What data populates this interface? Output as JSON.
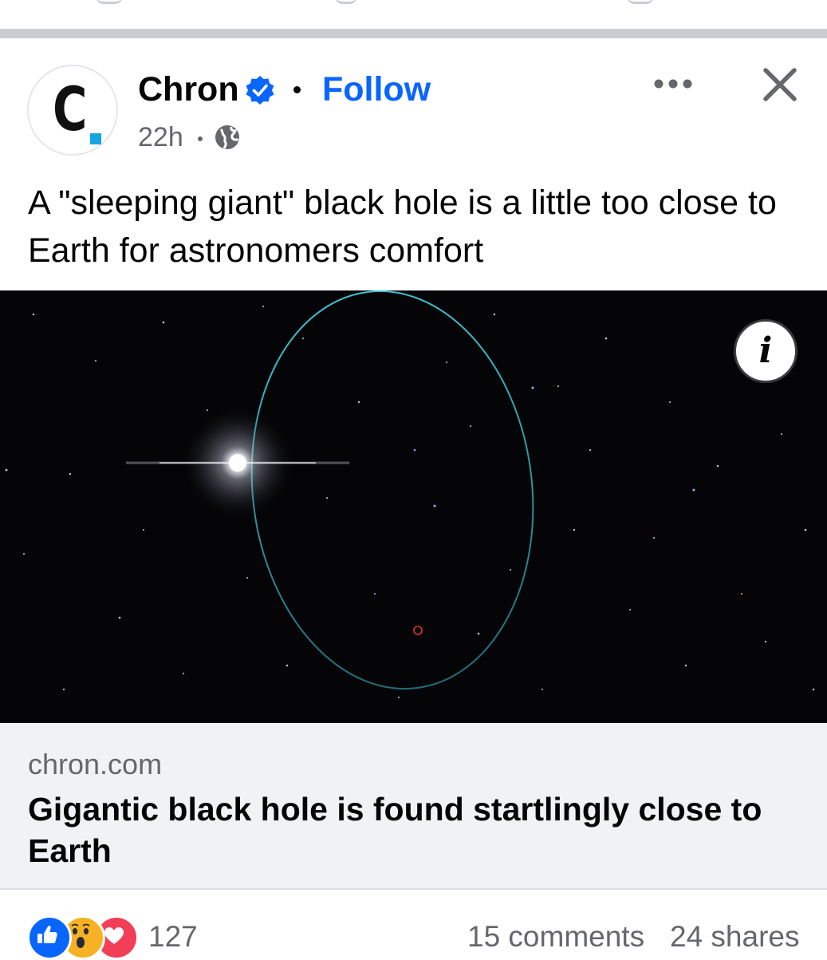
{
  "post": {
    "page_name": "Chron",
    "follow_label": "Follow",
    "time": "22h",
    "caption": "A \"sleeping giant\" black hole is a little too close to Earth for astronomers comfort",
    "image_info_label": "i",
    "icons": {
      "verified": "verified-badge-icon",
      "privacy": "globe-icon",
      "more": "more-options-icon",
      "close": "close-icon",
      "info": "info-icon"
    },
    "avatar": {
      "letter": "C",
      "accent_color": "#14a6de"
    }
  },
  "link_preview": {
    "domain": "chron.com",
    "title": "Gigantic black hole is found startlingly close to Earth"
  },
  "engagement": {
    "reactions": [
      "like",
      "wow",
      "love"
    ],
    "reaction_count": "127",
    "comments": "15 comments",
    "shares": "24 shares"
  },
  "colors": {
    "accent": "#0866ff",
    "secondary_text": "#65676b",
    "card_background": "#f0f2f5",
    "orbit": "#3fb7c7"
  }
}
